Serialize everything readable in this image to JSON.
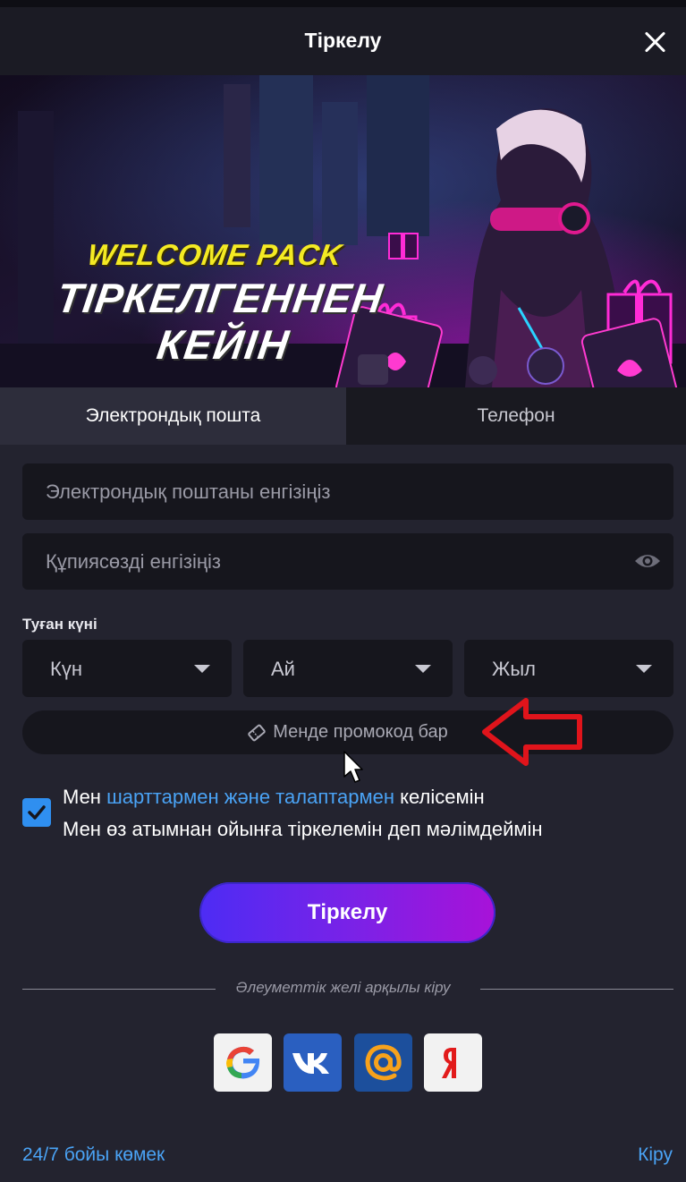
{
  "header": {
    "title": "Тіркелу"
  },
  "banner": {
    "line1": "WELCOME PACK",
    "line2": "ТІРКЕЛГЕННЕН",
    "line3": "КЕЙІН"
  },
  "tabs": [
    {
      "label": "Электрондық пошта",
      "active": true
    },
    {
      "label": "Телефон",
      "active": false
    }
  ],
  "form": {
    "email_placeholder": "Электрондық поштаны енгізіңіз",
    "password_placeholder": "Құпиясөзді енгізіңіз",
    "dob_label": "Туған күні",
    "day": "Күн",
    "month": "Ай",
    "year": "Жыл",
    "promo_label": "Менде промокод бар",
    "agree_prefix": "Мен",
    "agree_link": "шарттармен және талаптармен",
    "agree_suffix": "келісемін",
    "agree_line2": "Мен өз атымнан ойынға тіркелемін деп мәлімдеймін",
    "agree_checked": true,
    "submit_label": "Тіркелу"
  },
  "social": {
    "divider_text": "Әлеуметтік желі арқылы кіру",
    "providers": [
      {
        "name": "google",
        "icon": "google-icon"
      },
      {
        "name": "vk",
        "icon": "vk-icon"
      },
      {
        "name": "mail",
        "icon": "at-icon"
      },
      {
        "name": "yandex",
        "icon": "yandex-icon"
      }
    ]
  },
  "footer": {
    "help": "24/7 бойы көмек",
    "login": "Кіру"
  },
  "colors": {
    "background": "#23232f",
    "link": "#4aa3f5",
    "accent": "#2f8ff0",
    "button_gradient_start": "#4d2cf4",
    "button_gradient_end": "#a812d8",
    "annotation_arrow": "#e0141b"
  }
}
